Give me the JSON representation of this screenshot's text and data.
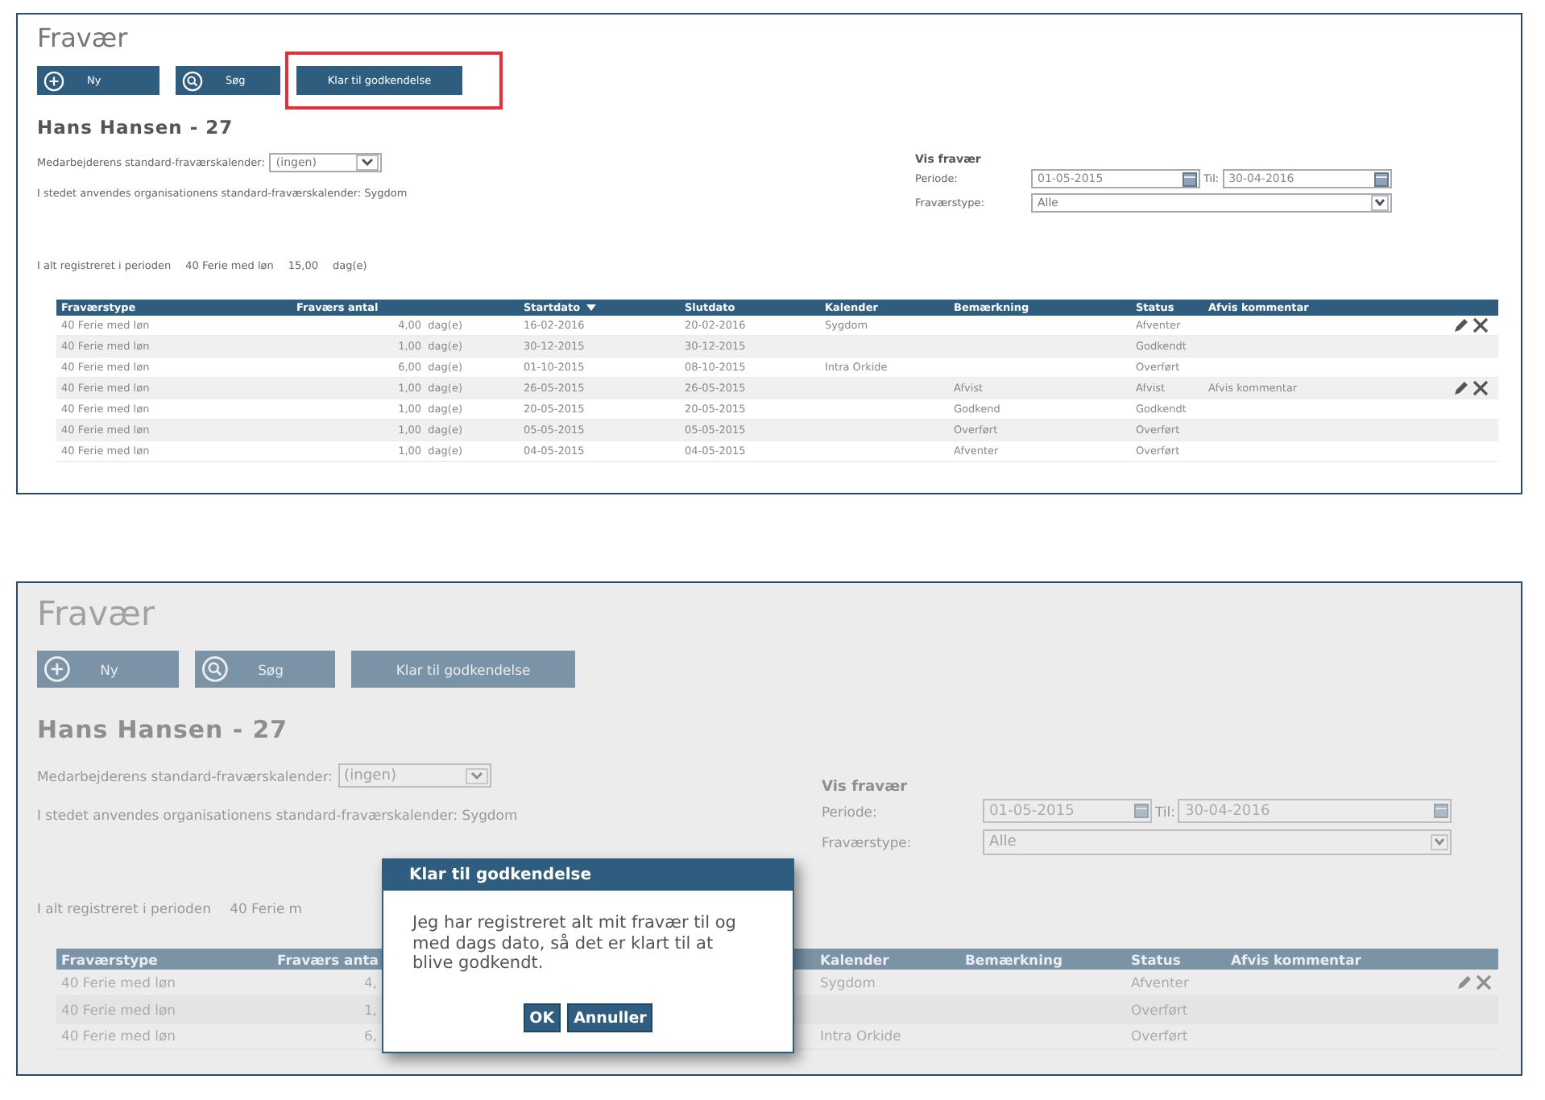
{
  "panels": [
    {
      "dimmed": false,
      "title": "Fravær",
      "buttons": [
        {
          "label": "Ny",
          "highlighted": false
        },
        {
          "label": "Søg",
          "highlighted": false
        },
        {
          "label": "Klar til godkendelse",
          "highlighted": true
        }
      ],
      "employee": "Hans Hansen - 27",
      "calendar_label": "Medarbejderens standard-fraværskalender:",
      "calendar_select": "(ingen)",
      "fallback_note": "I stedet anvendes organisationens standard-fraværskalender: Sygdom",
      "totals": [
        "I alt registreret i perioden",
        "40 Ferie med løn",
        "15,00",
        "dag(e)"
      ],
      "filter": {
        "title": "Vis fravær",
        "period_label": "Periode:",
        "from": "01-05-2015",
        "to_label": "Til:",
        "to": "30-04-2016",
        "type_label": "Fraværstype:",
        "type": "Alle"
      },
      "table": {
        "columns": [
          {
            "label": "Fraværstype",
            "sorted": false
          },
          {
            "label": "Fraværs antal",
            "sorted": false
          },
          {
            "label": "Startdato",
            "sorted": true
          },
          {
            "label": "Slutdato",
            "sorted": false
          },
          {
            "label": "Kalender",
            "sorted": false
          },
          {
            "label": "Bemærkning",
            "sorted": false
          },
          {
            "label": "Status",
            "sorted": false
          },
          {
            "label": "Afvis kommentar",
            "sorted": false
          }
        ],
        "rows": [
          {
            "cells": [
              "40 Ferie med løn",
              "4,00  dag(e)",
              "16-02-2016",
              "20-02-2016",
              "Sygdom",
              null,
              "Afventer",
              null
            ],
            "editable": true
          },
          {
            "cells": [
              "40 Ferie med løn",
              "1,00  dag(e)",
              "30-12-2015",
              "30-12-2015",
              null,
              null,
              "Godkendt",
              null
            ],
            "editable": false
          },
          {
            "cells": [
              "40 Ferie med løn",
              "6,00  dag(e)",
              "01-10-2015",
              "08-10-2015",
              "Intra Orkide",
              null,
              "Overført",
              null
            ],
            "editable": false
          },
          {
            "cells": [
              "40 Ferie med løn",
              "1,00  dag(e)",
              "26-05-2015",
              "26-05-2015",
              null,
              "Afvist",
              "Afvist",
              "Afvis kommentar"
            ],
            "editable": true
          },
          {
            "cells": [
              "40 Ferie med løn",
              "1,00  dag(e)",
              "20-05-2015",
              "20-05-2015",
              null,
              "Godkend",
              "Godkendt",
              null
            ],
            "editable": false
          },
          {
            "cells": [
              "40 Ferie med løn",
              "1,00  dag(e)",
              "05-05-2015",
              "05-05-2015",
              null,
              "Overført",
              "Overført",
              null
            ],
            "editable": false
          },
          {
            "cells": [
              "40 Ferie med løn",
              "1,00  dag(e)",
              "04-05-2015",
              "04-05-2015",
              null,
              "Afventer",
              "Overført",
              null
            ],
            "editable": false
          }
        ]
      }
    },
    {
      "dimmed": true,
      "title": "Fravær",
      "buttons": [
        {
          "label": "Ny",
          "highlighted": false
        },
        {
          "label": "Søg",
          "highlighted": false
        },
        {
          "label": "Klar til godkendelse",
          "highlighted": false
        }
      ],
      "employee": "Hans Hansen - 27",
      "calendar_label": "Medarbejderens standard-fraværskalender:",
      "calendar_select": "(ingen)",
      "fallback_note": "I stedet anvendes organisationens standard-fraværskalender: Sygdom",
      "totals": [
        "I alt registreret i perioden",
        "40 Ferie m"
      ],
      "filter": {
        "title": "Vis fravær",
        "period_label": "Periode:",
        "from": "01-05-2015",
        "to_label": "Til:",
        "to": "30-04-2016",
        "type_label": "Fraværstype:",
        "type": "Alle"
      },
      "table": {
        "columns": [
          {
            "label": "Fraværstype",
            "sorted": false
          },
          {
            "label": "Fraværs anta",
            "sorted": false
          },
          {
            "label": "Kalender",
            "sorted": false
          },
          {
            "label": "Bemærkning",
            "sorted": false
          },
          {
            "label": "Status",
            "sorted": false
          },
          {
            "label": "Afvis kommentar",
            "sorted": false
          }
        ],
        "rows": [
          {
            "cells": [
              "40 Ferie med løn",
              "4,",
              "Sygdom",
              null,
              "Afventer",
              null
            ],
            "editable": true
          },
          {
            "cells": [
              "40 Ferie med løn",
              "1,",
              null,
              null,
              "Overført",
              null
            ],
            "editable": false
          },
          {
            "cells": [
              "40 Ferie med løn",
              "6,",
              "Intra Orkide",
              null,
              "Overført",
              null
            ],
            "editable": false
          }
        ]
      },
      "dialog": {
        "title": "Klar til godkendelse",
        "message": "Jeg har registreret alt mit fravær til og med dags dato, så det er klart til at blive godkendt.",
        "buttons": [
          "OK",
          "Annuller"
        ]
      }
    }
  ]
}
